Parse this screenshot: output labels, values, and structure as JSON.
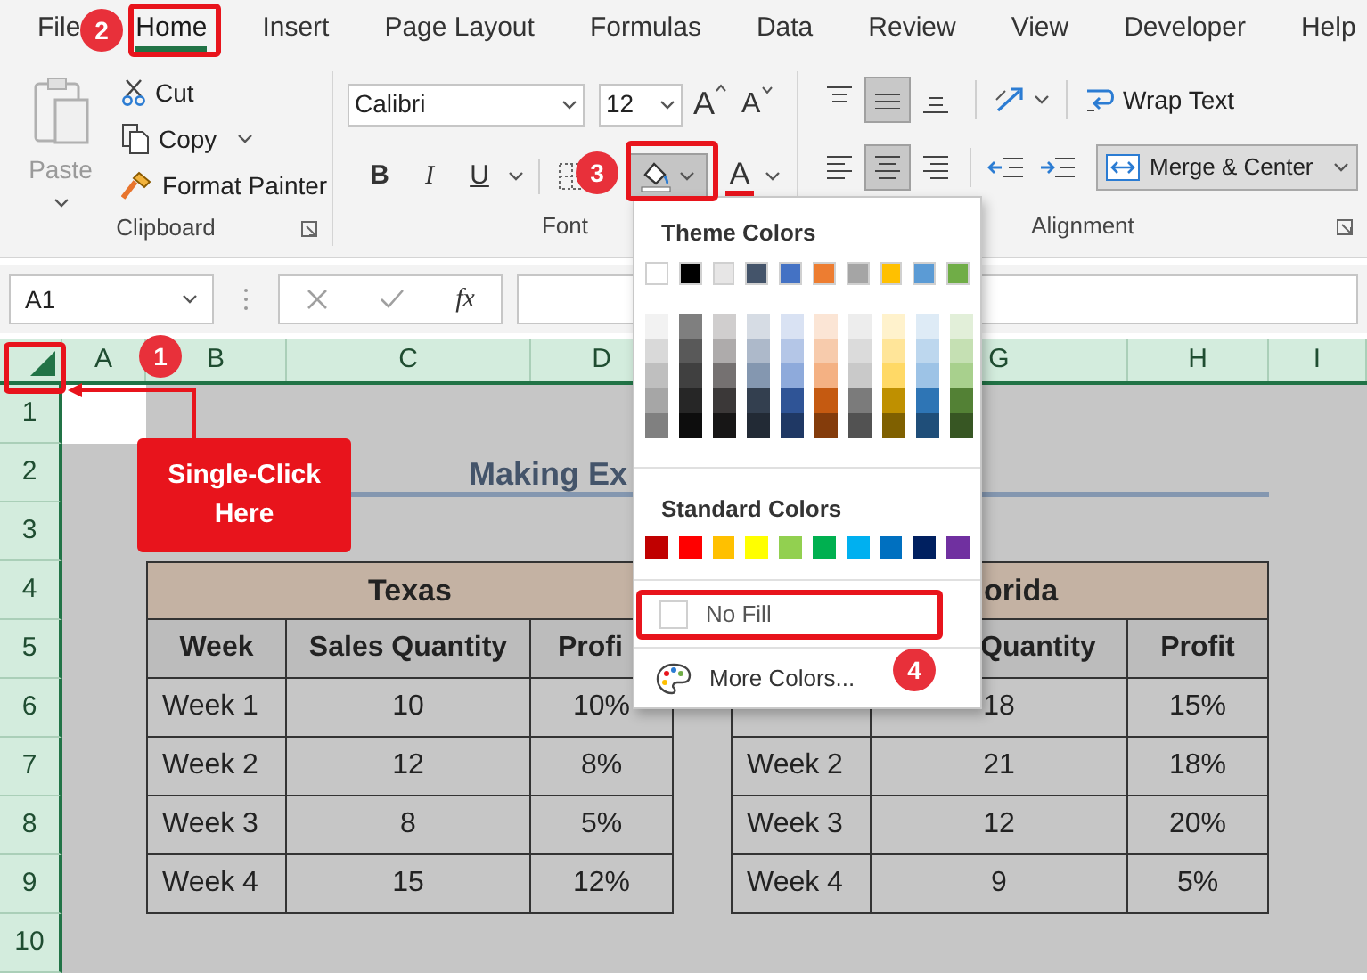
{
  "menu_tabs": [
    {
      "label": "File",
      "selected": false
    },
    {
      "label": "Home",
      "selected": true
    },
    {
      "label": "Insert",
      "selected": false
    },
    {
      "label": "Page Layout",
      "selected": false
    },
    {
      "label": "Formulas",
      "selected": false
    },
    {
      "label": "Data",
      "selected": false
    },
    {
      "label": "Review",
      "selected": false
    },
    {
      "label": "View",
      "selected": false
    },
    {
      "label": "Developer",
      "selected": false
    },
    {
      "label": "Help",
      "selected": false
    }
  ],
  "clipboard": {
    "paste": {
      "label": "Paste",
      "disabled": true
    },
    "cut": "Cut",
    "copy": "Copy",
    "format_painter": "Format Painter",
    "label": "Clipboard"
  },
  "font": {
    "font_name": "Calibri",
    "font_size": "12",
    "grow": "A",
    "shrink": "A",
    "styles": [
      "B",
      "I",
      "U"
    ],
    "fill_color_pressed": true,
    "font_color": "A",
    "label": "Font"
  },
  "alignment": {
    "vertical": [
      {
        "selected": false
      },
      {
        "selected": true
      },
      {
        "selected": false
      }
    ],
    "horizontal": [
      {
        "selected": false
      },
      {
        "selected": true
      },
      {
        "selected": false
      }
    ],
    "wrap_text": "Wrap Text",
    "merge_center": "Merge & Center",
    "label": "Alignment"
  },
  "formula_bar": {
    "name_box": "A1",
    "function_label": "fx"
  },
  "sheet": {
    "column_headers": [
      "A",
      "B",
      "C",
      "D",
      "G",
      "H",
      "I"
    ],
    "row_headers": [
      "1",
      "2",
      "3",
      "4",
      "5",
      "6",
      "7",
      "8",
      "9",
      "10"
    ],
    "title": "Making Ex",
    "tables": [
      {
        "header": "Texas",
        "columns": [
          "Week",
          "Sales Quantity",
          "Profi"
        ],
        "rows": [
          [
            "Week 1",
            "10",
            "10%"
          ],
          [
            "Week 2",
            "12",
            "8%"
          ],
          [
            "Week 3",
            "8",
            "5%"
          ],
          [
            "Week 4",
            "15",
            "12%"
          ]
        ]
      },
      {
        "header": "orida",
        "columns": [
          "",
          "Quantity",
          "Profit"
        ],
        "rows": [
          [
            "",
            "18",
            "15%"
          ],
          [
            "Week 2",
            "21",
            "18%"
          ],
          [
            "Week 3",
            "12",
            "20%"
          ],
          [
            "Week 4",
            "9",
            "5%"
          ]
        ]
      }
    ]
  },
  "fill_menu": {
    "theme_title": "Theme Colors",
    "theme_colors": [
      {
        "color": "#ffffff",
        "shades": [
          {
            "color": "#f2f2f2"
          },
          {
            "color": "#d9d9d9"
          },
          {
            "color": "#bfbfbf"
          },
          {
            "color": "#a6a6a6"
          },
          {
            "color": "#808080"
          }
        ]
      },
      {
        "color": "#000000",
        "shades": [
          {
            "color": "#7f7f7f"
          },
          {
            "color": "#595959"
          },
          {
            "color": "#404040"
          },
          {
            "color": "#262626"
          },
          {
            "color": "#0d0d0d"
          }
        ]
      },
      {
        "color": "#e7e6e6",
        "shades": [
          {
            "color": "#d0cece"
          },
          {
            "color": "#aeabab"
          },
          {
            "color": "#757171"
          },
          {
            "color": "#3b3838"
          },
          {
            "color": "#171616"
          }
        ]
      },
      {
        "color": "#44546a",
        "shades": [
          {
            "color": "#d6dce4"
          },
          {
            "color": "#adb9ca"
          },
          {
            "color": "#8497b0"
          },
          {
            "color": "#333f4f"
          },
          {
            "color": "#222a35"
          }
        ]
      },
      {
        "color": "#4472c4",
        "shades": [
          {
            "color": "#d9e2f3"
          },
          {
            "color": "#b4c6e7"
          },
          {
            "color": "#8eaadb"
          },
          {
            "color": "#2f5496"
          },
          {
            "color": "#1f3864"
          }
        ]
      },
      {
        "color": "#ed7d31",
        "shades": [
          {
            "color": "#fbe5d5"
          },
          {
            "color": "#f7cbac"
          },
          {
            "color": "#f4b183"
          },
          {
            "color": "#c55a11"
          },
          {
            "color": "#843c0b"
          }
        ]
      },
      {
        "color": "#a5a5a5",
        "shades": [
          {
            "color": "#ededed"
          },
          {
            "color": "#dbdbdb"
          },
          {
            "color": "#c9c9c9"
          },
          {
            "color": "#7b7b7b"
          },
          {
            "color": "#525252"
          }
        ]
      },
      {
        "color": "#ffc000",
        "shades": [
          {
            "color": "#fff2cc"
          },
          {
            "color": "#ffe599"
          },
          {
            "color": "#ffd966"
          },
          {
            "color": "#bf9000"
          },
          {
            "color": "#7f6000"
          }
        ]
      },
      {
        "color": "#5b9bd5",
        "shades": [
          {
            "color": "#deebf6"
          },
          {
            "color": "#bdd7ee"
          },
          {
            "color": "#9dc3e6"
          },
          {
            "color": "#2e75b5"
          },
          {
            "color": "#1f4e79"
          }
        ]
      },
      {
        "color": "#70ad47",
        "shades": [
          {
            "color": "#e2efd9"
          },
          {
            "color": "#c5e0b3"
          },
          {
            "color": "#a8d08d"
          },
          {
            "color": "#538135"
          },
          {
            "color": "#375623"
          }
        ]
      }
    ],
    "standard_title": "Standard Colors",
    "standard_colors": [
      {
        "color": "#c00000"
      },
      {
        "color": "#ff0000"
      },
      {
        "color": "#ffc000"
      },
      {
        "color": "#ffff00"
      },
      {
        "color": "#92d050"
      },
      {
        "color": "#00b050"
      },
      {
        "color": "#00b0f0"
      },
      {
        "color": "#0070c0"
      },
      {
        "color": "#002060"
      },
      {
        "color": "#7030a0"
      }
    ],
    "no_fill": "No Fill",
    "more_colors": "More Colors..."
  },
  "annotations": {
    "steps": [
      "1",
      "2",
      "3",
      "4"
    ],
    "callout": "Single-Click Here"
  }
}
